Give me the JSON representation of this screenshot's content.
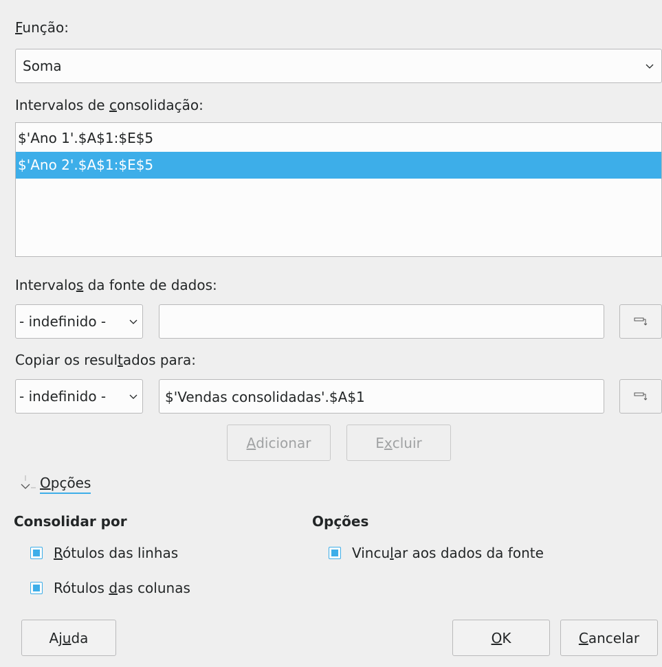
{
  "function": {
    "label_pre": "",
    "label_mn": "F",
    "label_post": "unção:",
    "value": "Soma"
  },
  "consolidation": {
    "label_pre": "Intervalos de ",
    "label_mn": "c",
    "label_post": "onsolidação:",
    "rows": [
      "$'Ano 1'.$A$1:$E$5",
      "$'Ano 2'.$A$1:$E$5"
    ]
  },
  "source": {
    "label_pre": "Intervalo",
    "label_mn": "s",
    "label_post": " da fonte de dados:",
    "combo_value": "- indefinido -",
    "input_value": ""
  },
  "copy": {
    "label_pre": "Copiar os resul",
    "label_mn": "t",
    "label_post": "ados para:",
    "combo_value": "- indefinido -",
    "input_value": "$'Vendas consolidadas'.$A$1"
  },
  "buttons": {
    "add_mn": "A",
    "add_rest": "dicionar",
    "delete_pre": "E",
    "delete_mn": "x",
    "delete_post": "cluir",
    "help_pre": "Aj",
    "help_mn": "u",
    "help_post": "da",
    "ok_mn": "O",
    "ok_rest": "K",
    "cancel_mn": "C",
    "cancel_rest": "ancelar"
  },
  "options_expander": {
    "pre": "",
    "mn": "O",
    "post": "pções"
  },
  "consolidate_by": {
    "title": "Consolidar por",
    "row_labels": {
      "pre": "",
      "mn": "R",
      "post": "ótulos das linhas",
      "checked": true
    },
    "col_labels": {
      "pre": "Rótulos ",
      "mn": "d",
      "post": "as colunas",
      "checked": true
    }
  },
  "options": {
    "title": "Opções",
    "link": {
      "pre": "Vincu",
      "mn": "l",
      "post": "ar aos dados da fonte",
      "checked": true
    }
  },
  "colors": {
    "accent": "#3daee9",
    "window_bg": "#efefef"
  }
}
